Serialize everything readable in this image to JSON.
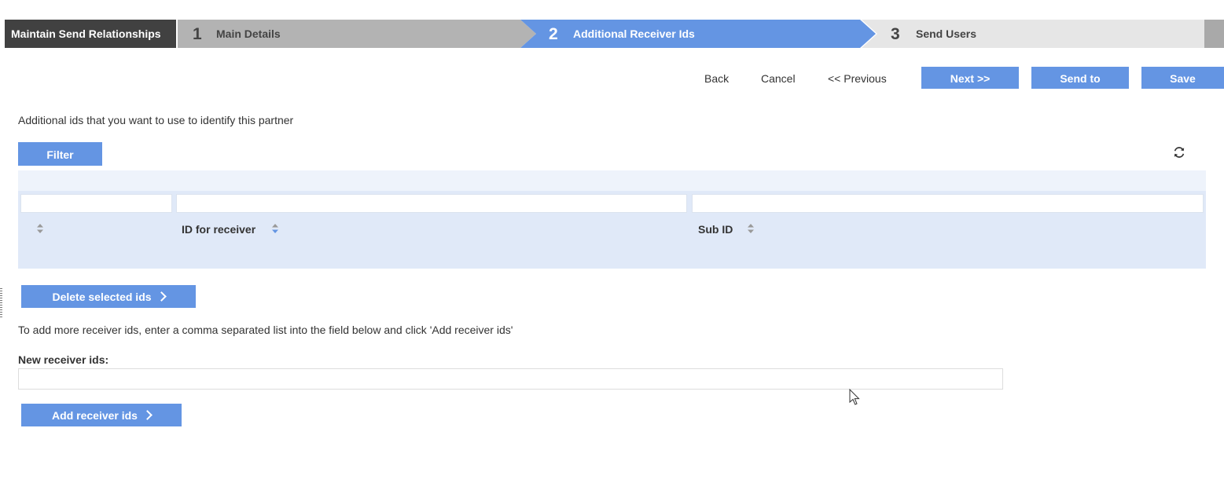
{
  "wizard": {
    "title": "Maintain Send Relationships",
    "steps": [
      {
        "number": "1",
        "label": "Main Details"
      },
      {
        "number": "2",
        "label": "Additional Receiver Ids"
      },
      {
        "number": "3",
        "label": "Send Users"
      }
    ],
    "active_step": "2"
  },
  "actions": {
    "back": "Back",
    "cancel": "Cancel",
    "previous": "<< Previous",
    "next": "Next >>",
    "send_to": "Send to",
    "save": "Save"
  },
  "description": "Additional ids that you want to use to identify this partner",
  "table": {
    "filter_label": "Filter",
    "refresh_icon": "refresh-icon",
    "columns": [
      {
        "label": ""
      },
      {
        "label": "ID for receiver"
      },
      {
        "label": "Sub ID"
      }
    ]
  },
  "delete_button": "Delete selected ids",
  "instructions": "To add more receiver ids, enter a comma separated list into the field below and click 'Add receiver ids'",
  "new_ids": {
    "label": "New receiver ids:",
    "value": ""
  },
  "add_button": "Add receiver ids",
  "colors": {
    "accent": "#6495e3",
    "title_bg": "#414141",
    "grid_bg": "#e0e9f8"
  }
}
